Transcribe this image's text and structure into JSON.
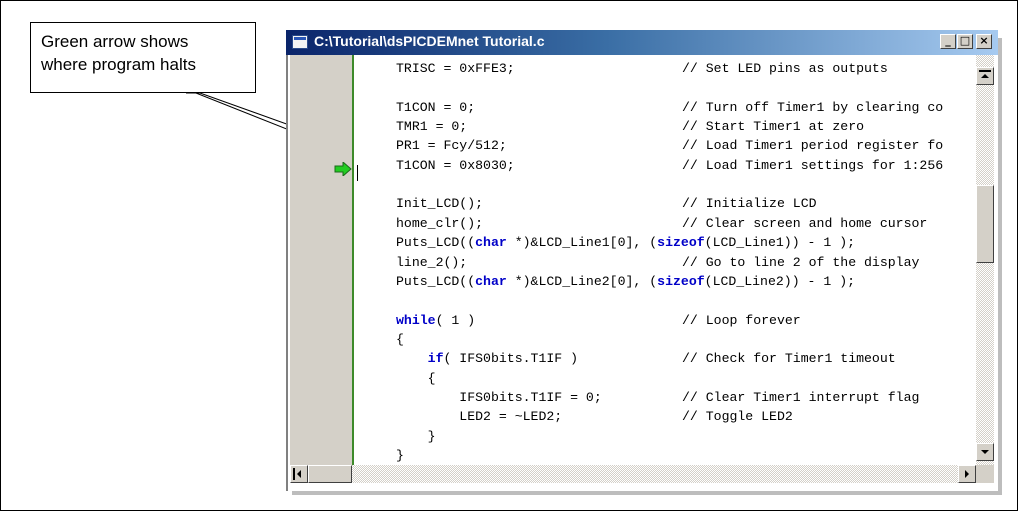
{
  "callout": {
    "line1": "Green arrow shows",
    "line2": "where program halts"
  },
  "window": {
    "title": "C:\\Tutorial\\dsPICDEMnet Tutorial.c",
    "buttons": {
      "minimize": "_",
      "maximize": "□",
      "close": "×"
    }
  },
  "colors": {
    "halt_arrow": "#22cc22",
    "keyword": "#0000c8",
    "titlebar_start": "#0a246a",
    "titlebar_end": "#a6caf0"
  },
  "icons": {
    "halt": "green-right-arrow-icon",
    "window": "document-icon"
  },
  "editor": {
    "halt_line_index": 4,
    "lines": [
      {
        "code": "TRISC = 0xFFE3;",
        "comment": "// Set LED pins as outputs"
      },
      {
        "code": "",
        "comment": ""
      },
      {
        "code": "T1CON = 0;",
        "comment": "// Turn off Timer1 by clearing co"
      },
      {
        "code": "TMR1 = 0;",
        "comment": "// Start Timer1 at zero"
      },
      {
        "code": "PR1 = Fcy/512;",
        "comment": "// Load Timer1 period register fo"
      },
      {
        "code": "T1CON = 0x8030;",
        "comment": "// Load Timer1 settings for 1:256"
      },
      {
        "code": "",
        "comment": ""
      },
      {
        "code": "Init_LCD();",
        "comment": "// Initialize LCD"
      },
      {
        "code": "home_clr();",
        "comment": "// Clear screen and home cursor"
      },
      {
        "code": "Puts_LCD((char *)&LCD_Line1[0], (sizeof(LCD_Line1)) - 1 );",
        "comment": ""
      },
      {
        "code": "line_2();",
        "comment": "// Go to line 2 of the display"
      },
      {
        "code": "Puts_LCD((char *)&LCD_Line2[0], (sizeof(LCD_Line2)) - 1 );",
        "comment": ""
      },
      {
        "code": "",
        "comment": ""
      },
      {
        "code": "while( 1 )",
        "comment": "// Loop forever"
      },
      {
        "code": "{",
        "comment": ""
      },
      {
        "code": "    if( IFS0bits.T1IF )",
        "comment": "// Check for Timer1 timeout"
      },
      {
        "code": "    {",
        "comment": ""
      },
      {
        "code": "        IFS0bits.T1IF = 0;",
        "comment": "// Clear Timer1 interrupt flag"
      },
      {
        "code": "        LED2 = ~LED2;",
        "comment": "// Toggle LED2"
      },
      {
        "code": "    }",
        "comment": ""
      },
      {
        "code": "}",
        "comment": ""
      }
    ]
  }
}
